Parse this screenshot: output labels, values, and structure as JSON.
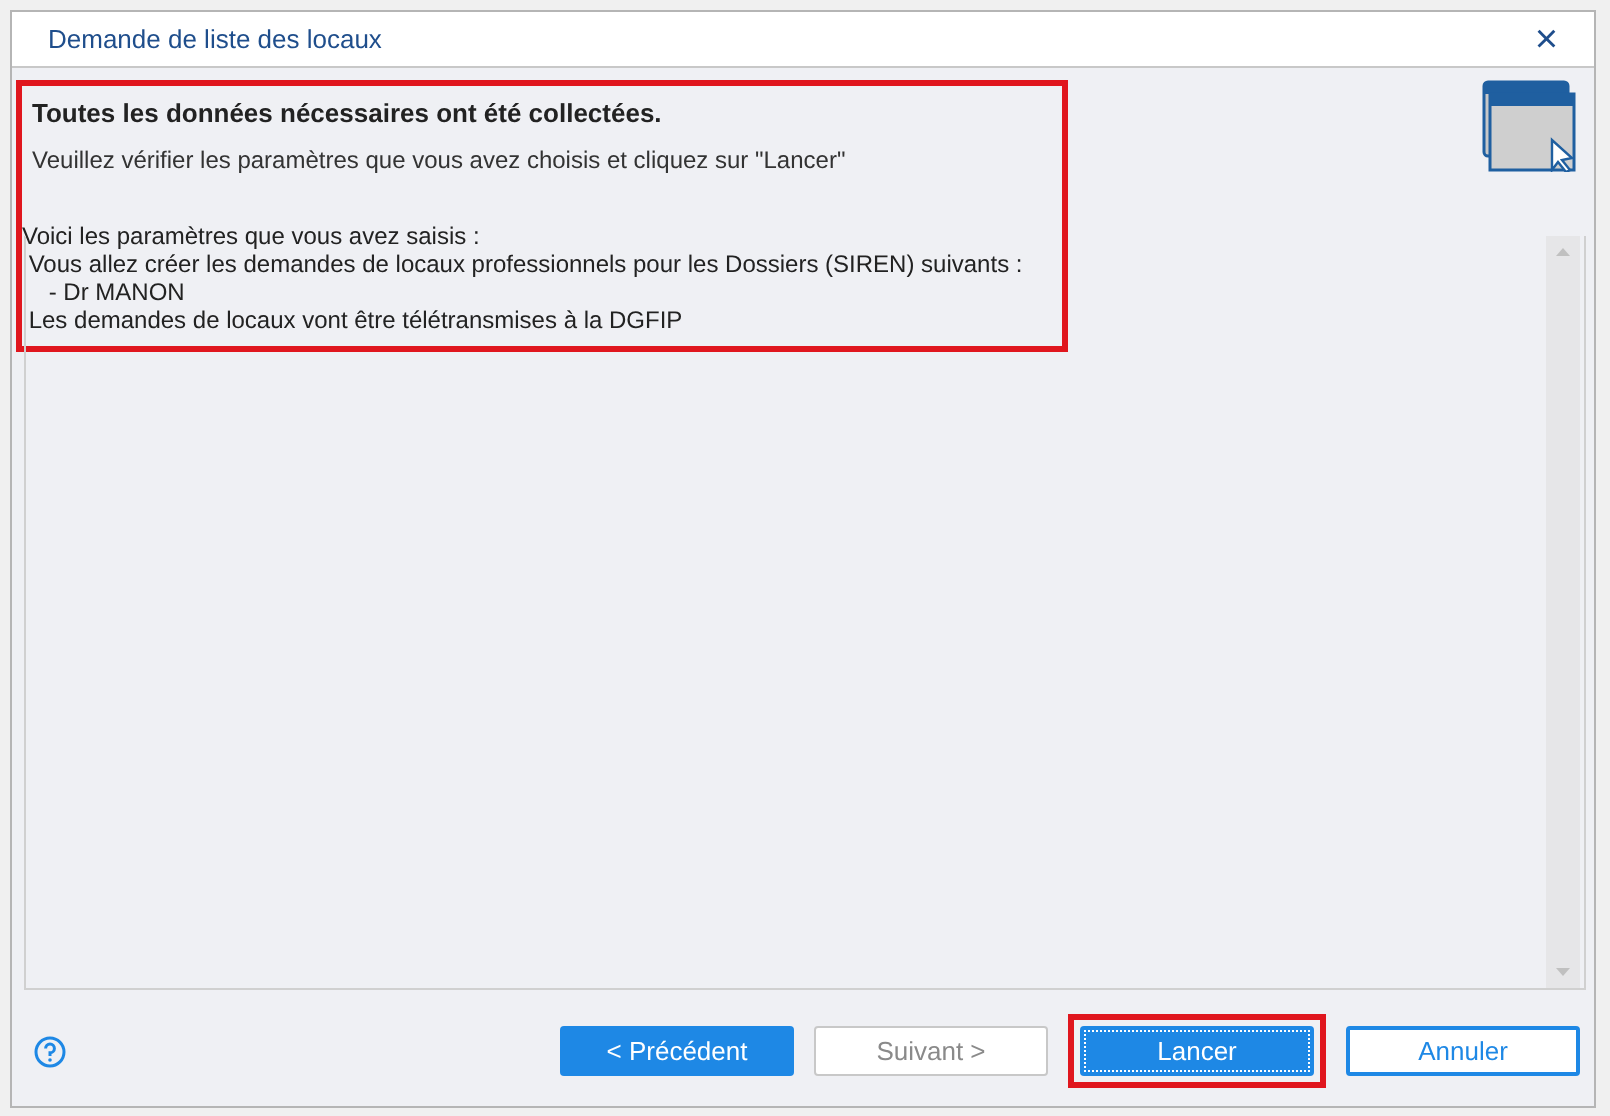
{
  "window": {
    "title": "Demande de liste des locaux",
    "close": "×"
  },
  "summary": {
    "heading": "Toutes les données nécessaires ont été collectées.",
    "instruction": "Veuillez vérifier les paramètres que vous avez choisis et cliquez sur \"Lancer\"",
    "highlighted": true
  },
  "details": [
    "Voici les paramètres que vous avez saisis :",
    " Vous allez créer les demandes de locaux professionnels pour les Dossiers (SIREN) suivants :",
    "    - Dr MANON",
    " Les demandes de locaux vont être télétransmises à la DGFIP"
  ],
  "buttons": [
    {
      "label": "< Précédent",
      "kind": "primary",
      "disabled": false,
      "focused": false,
      "highlighted": false
    },
    {
      "label": "Suivant >",
      "kind": "secondary",
      "disabled": true,
      "focused": false,
      "highlighted": false
    },
    {
      "label": "Lancer",
      "kind": "primary",
      "disabled": false,
      "focused": true,
      "highlighted": true
    },
    {
      "label": "Annuler",
      "kind": "outline",
      "disabled": false,
      "focused": false,
      "highlighted": false
    }
  ]
}
